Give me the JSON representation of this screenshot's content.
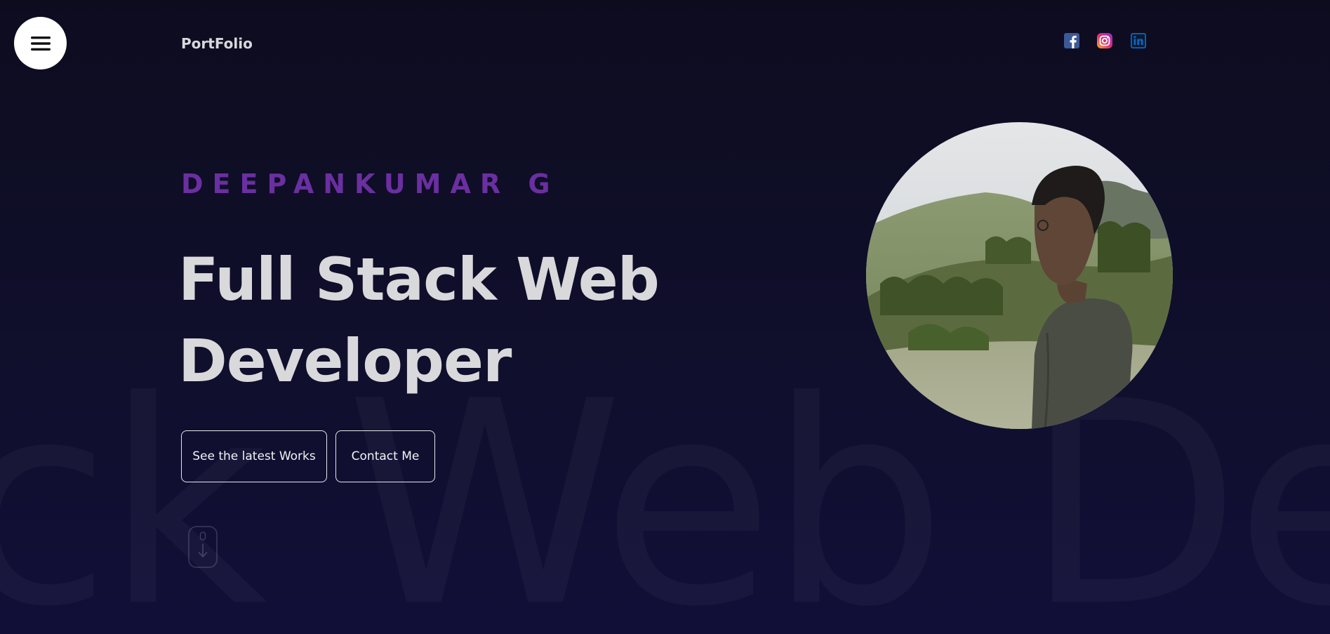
{
  "background_text": "ck Web De",
  "menu": {
    "icon": "hamburger-icon"
  },
  "header": {
    "logo": "PortFolio"
  },
  "social": [
    {
      "name": "facebook",
      "icon": "facebook-icon",
      "color": "#3b5998"
    },
    {
      "name": "instagram",
      "icon": "instagram-icon",
      "color": "#d6249f"
    },
    {
      "name": "linkedin",
      "icon": "linkedin-icon",
      "color": "#0a66c2"
    }
  ],
  "hero": {
    "name": "DEEPANKUMAR G",
    "title_line1": "Full Stack Web",
    "title_line2": "Developer",
    "primary_button": "See the latest Works",
    "secondary_button": "Contact Me",
    "scroll_icon": "mouse-scroll-icon"
  },
  "portrait": {
    "icon": "profile-photo"
  },
  "colors": {
    "background": "#0d0c1f",
    "accent": "#6a2fa0",
    "heading": "#d9d9dc",
    "button_border": "#e6e6ea"
  }
}
